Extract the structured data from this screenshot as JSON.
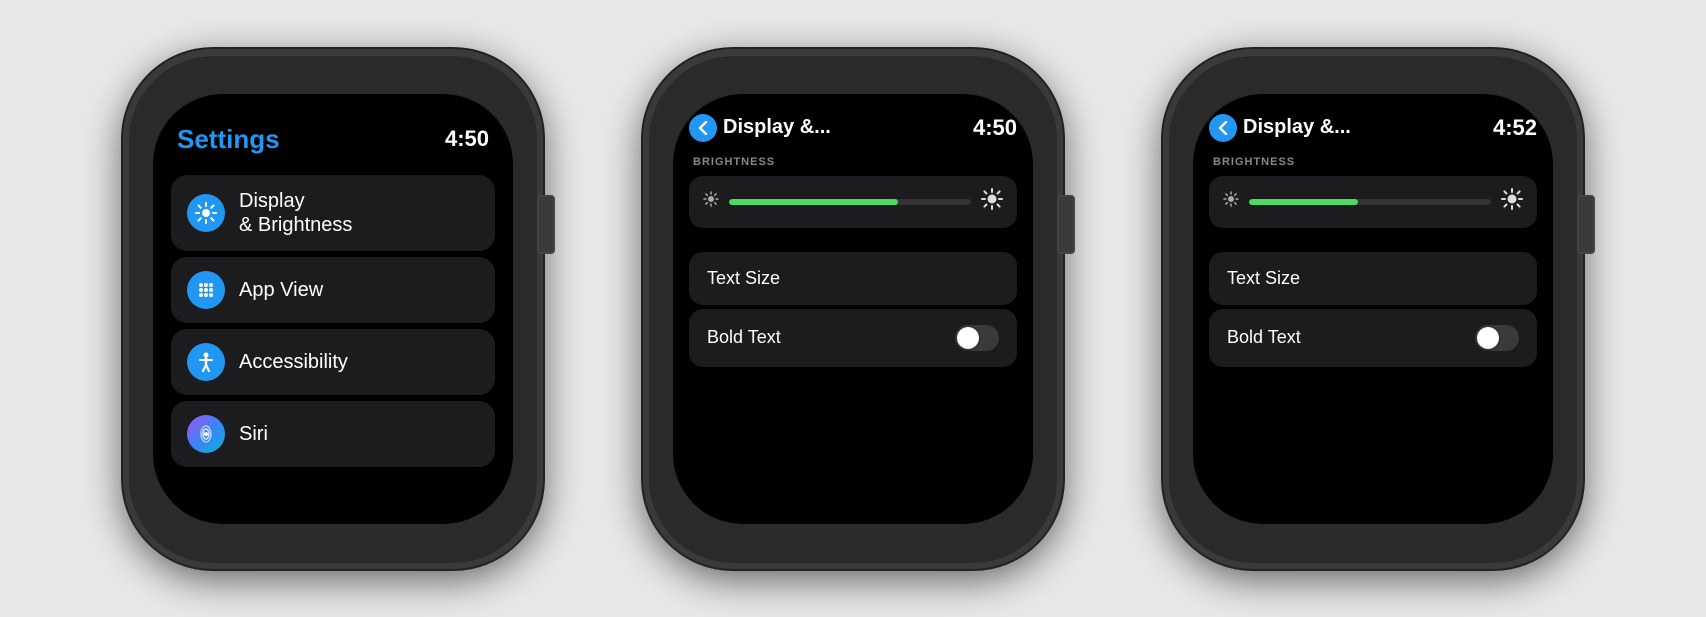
{
  "watch1": {
    "header": {
      "title": "Settings",
      "time": "4:50"
    },
    "items": [
      {
        "id": "display",
        "label": "Display\n& Brightness",
        "icon": "☀️",
        "icon_class": "icon-blue"
      },
      {
        "id": "appview",
        "label": "App View",
        "icon": "⊞",
        "icon_class": "icon-blue"
      },
      {
        "id": "accessibility",
        "label": "Accessibility",
        "icon": "♿",
        "icon_class": "icon-blue"
      },
      {
        "id": "siri",
        "label": "Siri",
        "icon": "◉",
        "icon_class": "icon-siri"
      }
    ]
  },
  "watch2": {
    "header": {
      "back_label": "‹",
      "title": "Display &...",
      "time": "4:50"
    },
    "brightness_label": "BRIGHTNESS",
    "text_size_label": "Text Size",
    "bold_text_label": "Bold Text",
    "bold_toggle": false,
    "brightness_fill_width": "70%"
  },
  "watch3": {
    "header": {
      "back_label": "‹",
      "title": "Display &...",
      "time": "4:52"
    },
    "brightness_label": "BRIGHTNESS",
    "text_size_label": "Text Size",
    "bold_text_label": "Bold Text",
    "bold_toggle": false,
    "brightness_fill_width": "45%"
  }
}
